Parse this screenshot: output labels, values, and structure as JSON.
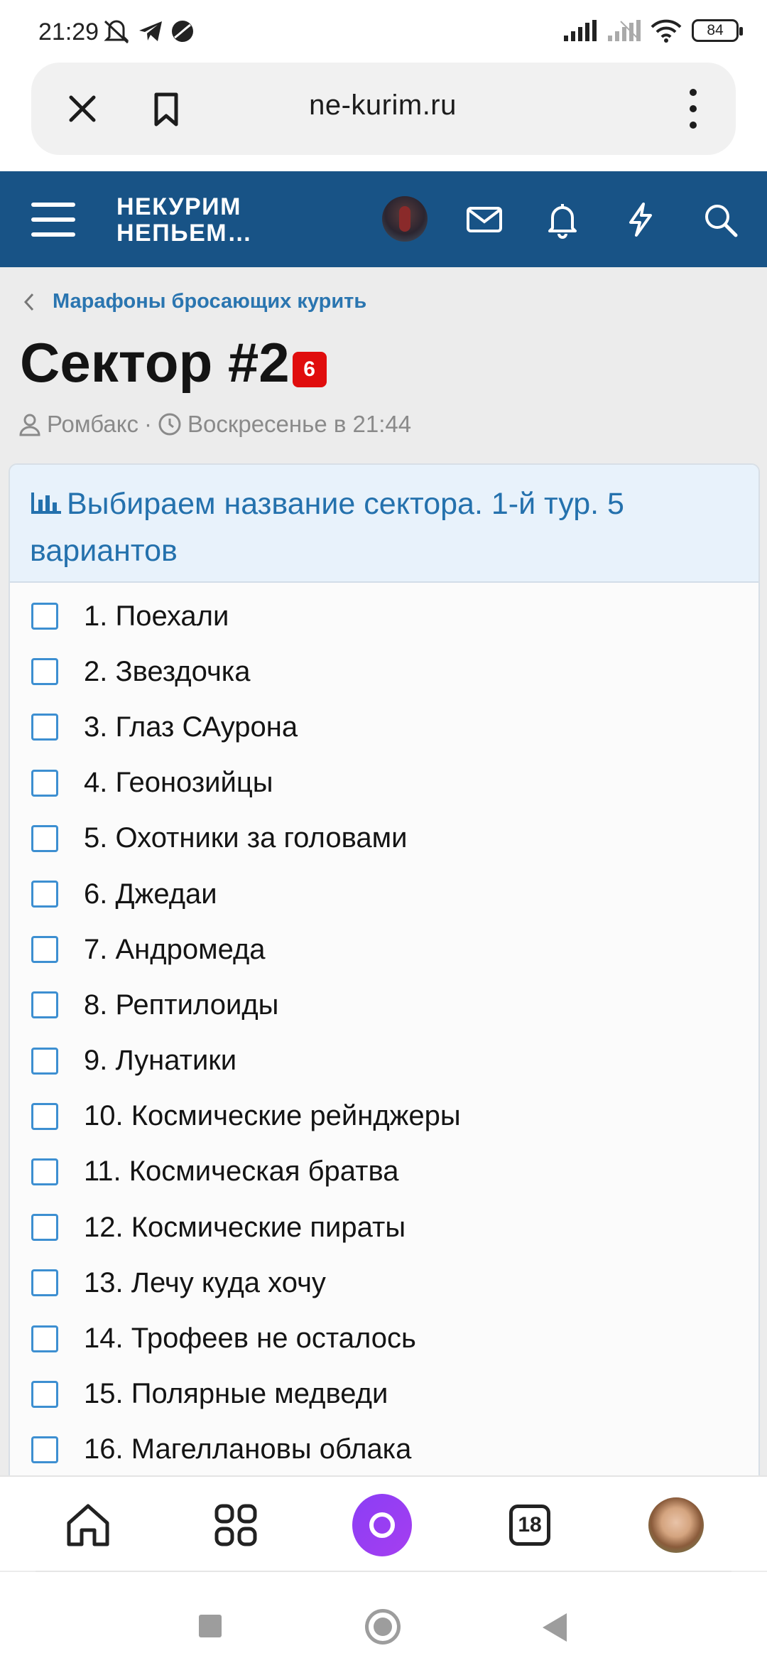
{
  "status_bar": {
    "time": "21:29",
    "battery": "84",
    "icons": [
      "mute-icon",
      "telegram-icon",
      "app-icon",
      "signal-icon",
      "signal-secondary-icon",
      "wifi-icon",
      "battery-icon"
    ]
  },
  "browser": {
    "url": "ne-kurim.ru",
    "tab_count": "18"
  },
  "site": {
    "logo_line1": "НЕКУРИМ",
    "logo_line2": "НЕПЬЕМ…"
  },
  "breadcrumb": {
    "label": "Марафоны бросающих курить"
  },
  "thread": {
    "title": "Сектор #2",
    "badge": "6",
    "author": "Ромбакс",
    "separator": "·",
    "date": "Воскресенье в 21:44"
  },
  "poll": {
    "question": "Выбираем название сектора. 1-й тур. 5 вариантов",
    "options": [
      "1. Поехали",
      "2. Звездочка",
      "3. Глаз САурона",
      "4. Геонозийцы",
      "5. Охотники за головами",
      "6. Джедаи",
      "7. Андромеда",
      "8. Рептилоиды",
      "9. Лунатики",
      "10. Космические рейнджеры",
      "11. Космическая братва",
      "12. Космические пираты",
      "13. Лечу куда хочу",
      "14. Трофеев не осталось",
      "15. Полярные медведи",
      "16. Магеллановы облака"
    ]
  },
  "colors": {
    "header_bg": "#185386",
    "link": "#2a75b0",
    "badge": "#e00d0d",
    "poll_header_bg": "#e8f2fb",
    "checkbox_border": "#3d8fd1",
    "alice": "#8b3df5"
  }
}
